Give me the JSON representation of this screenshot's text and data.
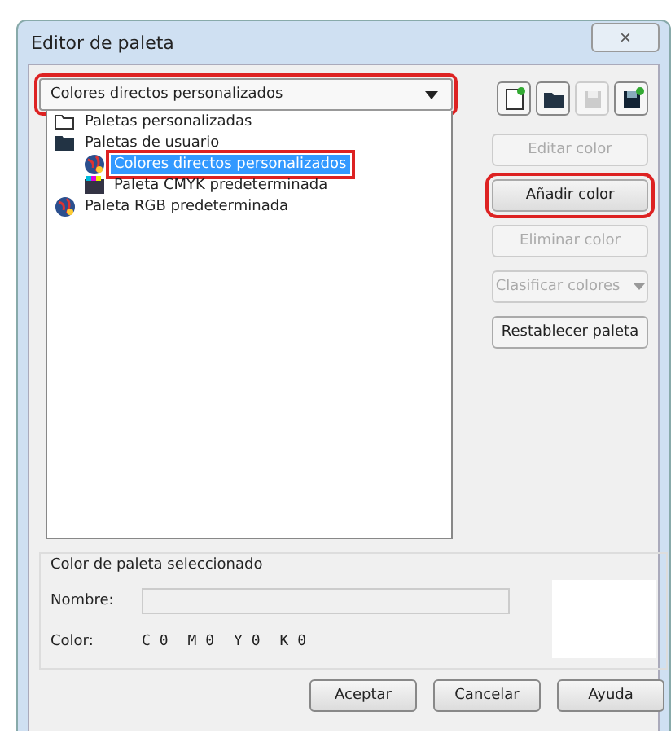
{
  "window": {
    "title": "Editor de paleta",
    "close": "×"
  },
  "palette_select": {
    "value": "Colores directos personalizados",
    "highlighted": true
  },
  "toolbar": [
    {
      "kind": "new",
      "disabled": false
    },
    {
      "kind": "open",
      "disabled": false
    },
    {
      "kind": "save",
      "disabled": true
    },
    {
      "kind": "saveas",
      "disabled": false
    }
  ],
  "tree": [
    {
      "label": "Paletas personalizadas",
      "kind": "folder-outline",
      "selected": false,
      "highlighted": false
    },
    {
      "label": "Paletas de usuario",
      "kind": "folder",
      "selected": false,
      "highlighted": false,
      "expanded": true,
      "children": [
        {
          "label": "Colores directos personalizados",
          "kind": "globe",
          "selected": true,
          "highlighted": true
        },
        {
          "label": "Paleta CMYK predeterminada",
          "kind": "cmyk",
          "selected": false,
          "highlighted": false
        }
      ]
    },
    {
      "label": "Paleta RGB predeterminada",
      "kind": "globe",
      "selected": false,
      "highlighted": false
    }
  ],
  "side_buttons": [
    {
      "label": "Editar color",
      "disabled": true,
      "highlighted": false,
      "kind": "plain"
    },
    {
      "label": "Añadir color",
      "disabled": false,
      "highlighted": true,
      "kind": "plain"
    },
    {
      "label": "Eliminar color",
      "disabled": true,
      "highlighted": false,
      "kind": "plain"
    },
    {
      "label": "Clasificar colores",
      "disabled": true,
      "highlighted": false,
      "kind": "menu"
    },
    {
      "label": "Restablecer paleta",
      "disabled": false,
      "highlighted": false,
      "kind": "plain"
    }
  ],
  "selected_color": {
    "title": "Color de paleta seleccionado",
    "name_label": "Nombre:",
    "color_label": "Color:",
    "components": [
      "C 0",
      "M 0",
      "Y 0",
      "K 0"
    ]
  },
  "buttons": [
    "Aceptar",
    "Cancelar",
    "Ayuda"
  ]
}
